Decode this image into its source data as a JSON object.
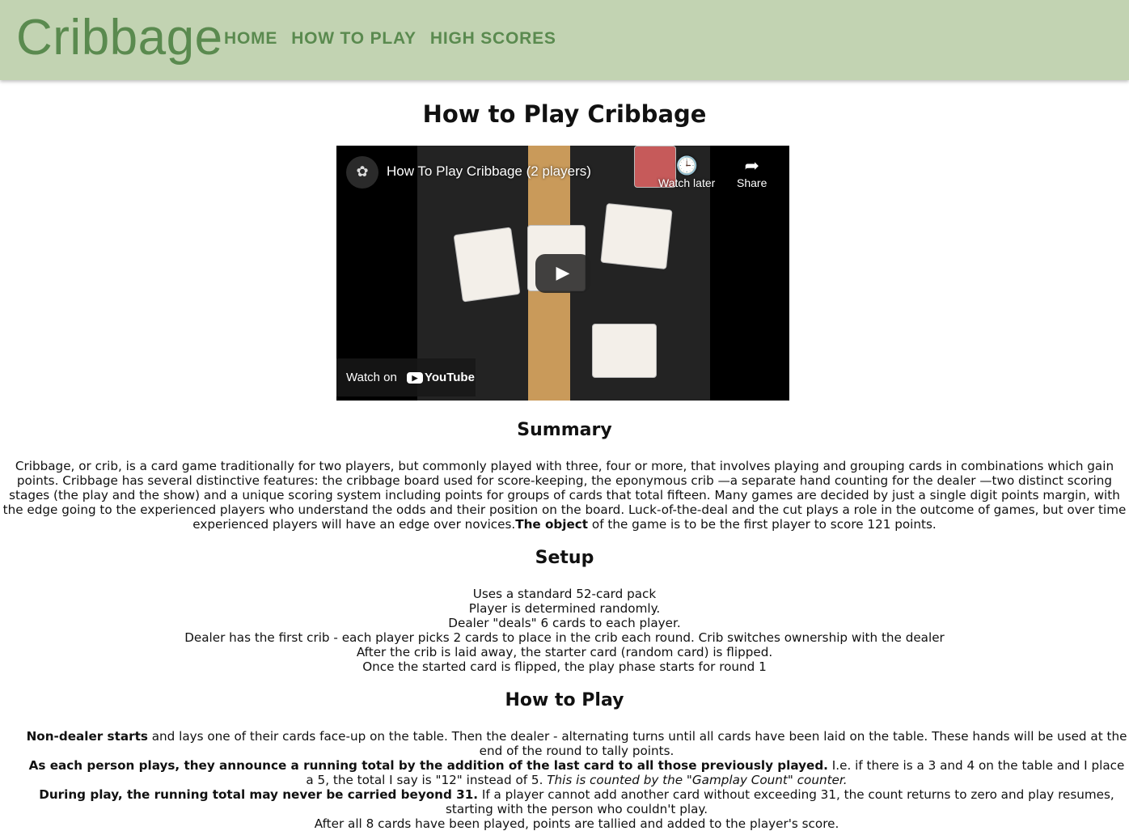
{
  "header": {
    "brand": "Cribbage",
    "nav": [
      "HOME",
      "HOW TO PLAY",
      "HIGH SCORES"
    ]
  },
  "page": {
    "title": "How to Play Cribbage"
  },
  "video": {
    "title": "How To Play Cribbage (2 players)",
    "watch_later": "Watch later",
    "share": "Share",
    "watch_on": "Watch on",
    "youtube": "YouTube"
  },
  "summary": {
    "heading": "Summary",
    "text": "Cribbage, or crib, is a card game traditionally for two players, but commonly played with three, four or more, that involves playing and grouping cards in combinations which gain points. Cribbage has several distinctive features: the cribbage board used for score-keeping, the eponymous crib —a separate hand counting for the dealer —two distinct scoring stages (the play and the show) and a unique scoring system including points for groups of cards that total fifteen. Many games are decided by just a single digit points margin, with the edge going to the experienced players who understand the odds and their position on the board. Luck-of-the-deal and the cut plays a role in the outcome of games, but over time experienced players will have an edge over novices.",
    "object_bold": "The object",
    "object_rest": " of the game is to be the first player to score 121 points."
  },
  "setup": {
    "heading": "Setup",
    "items": [
      "Uses a standard 52-card pack",
      "Player is determined randomly.",
      "Dealer \"deals\" 6 cards to each player.",
      "Dealer has the first crib - each player picks 2 cards to place in the crib each round. Crib switches ownership with the dealer",
      "After the crib is laid away, the starter card (random card) is flipped.",
      "Once the started card is flipped, the play phase starts for round 1"
    ]
  },
  "howto": {
    "heading": "How to Play",
    "items": [
      {
        "bold": "Non-dealer starts",
        "text": " and lays one of their cards face-up on the table. Then the dealer - alternating turns until all cards have been laid on the table. These hands will be used at the end of the round to tally points."
      },
      {
        "bold": "As each person plays, they announce a running total by the addition of the last card to all those previously played.",
        "text": " I.e. if there is a 3 and 4 on the table and I place a 5, the total I say is \"12\" instead of 5. ",
        "italic": "This is counted by the \"Gamplay Count\" counter."
      },
      {
        "bold": "During play, the running total may never be carried beyond 31.",
        "text": " If a player cannot add another card without exceeding 31, the count returns to zero and play resumes, starting with the person who couldn't play."
      },
      {
        "text": "After all 8 cards have been played, points are tallied and added to the player's score."
      }
    ]
  }
}
